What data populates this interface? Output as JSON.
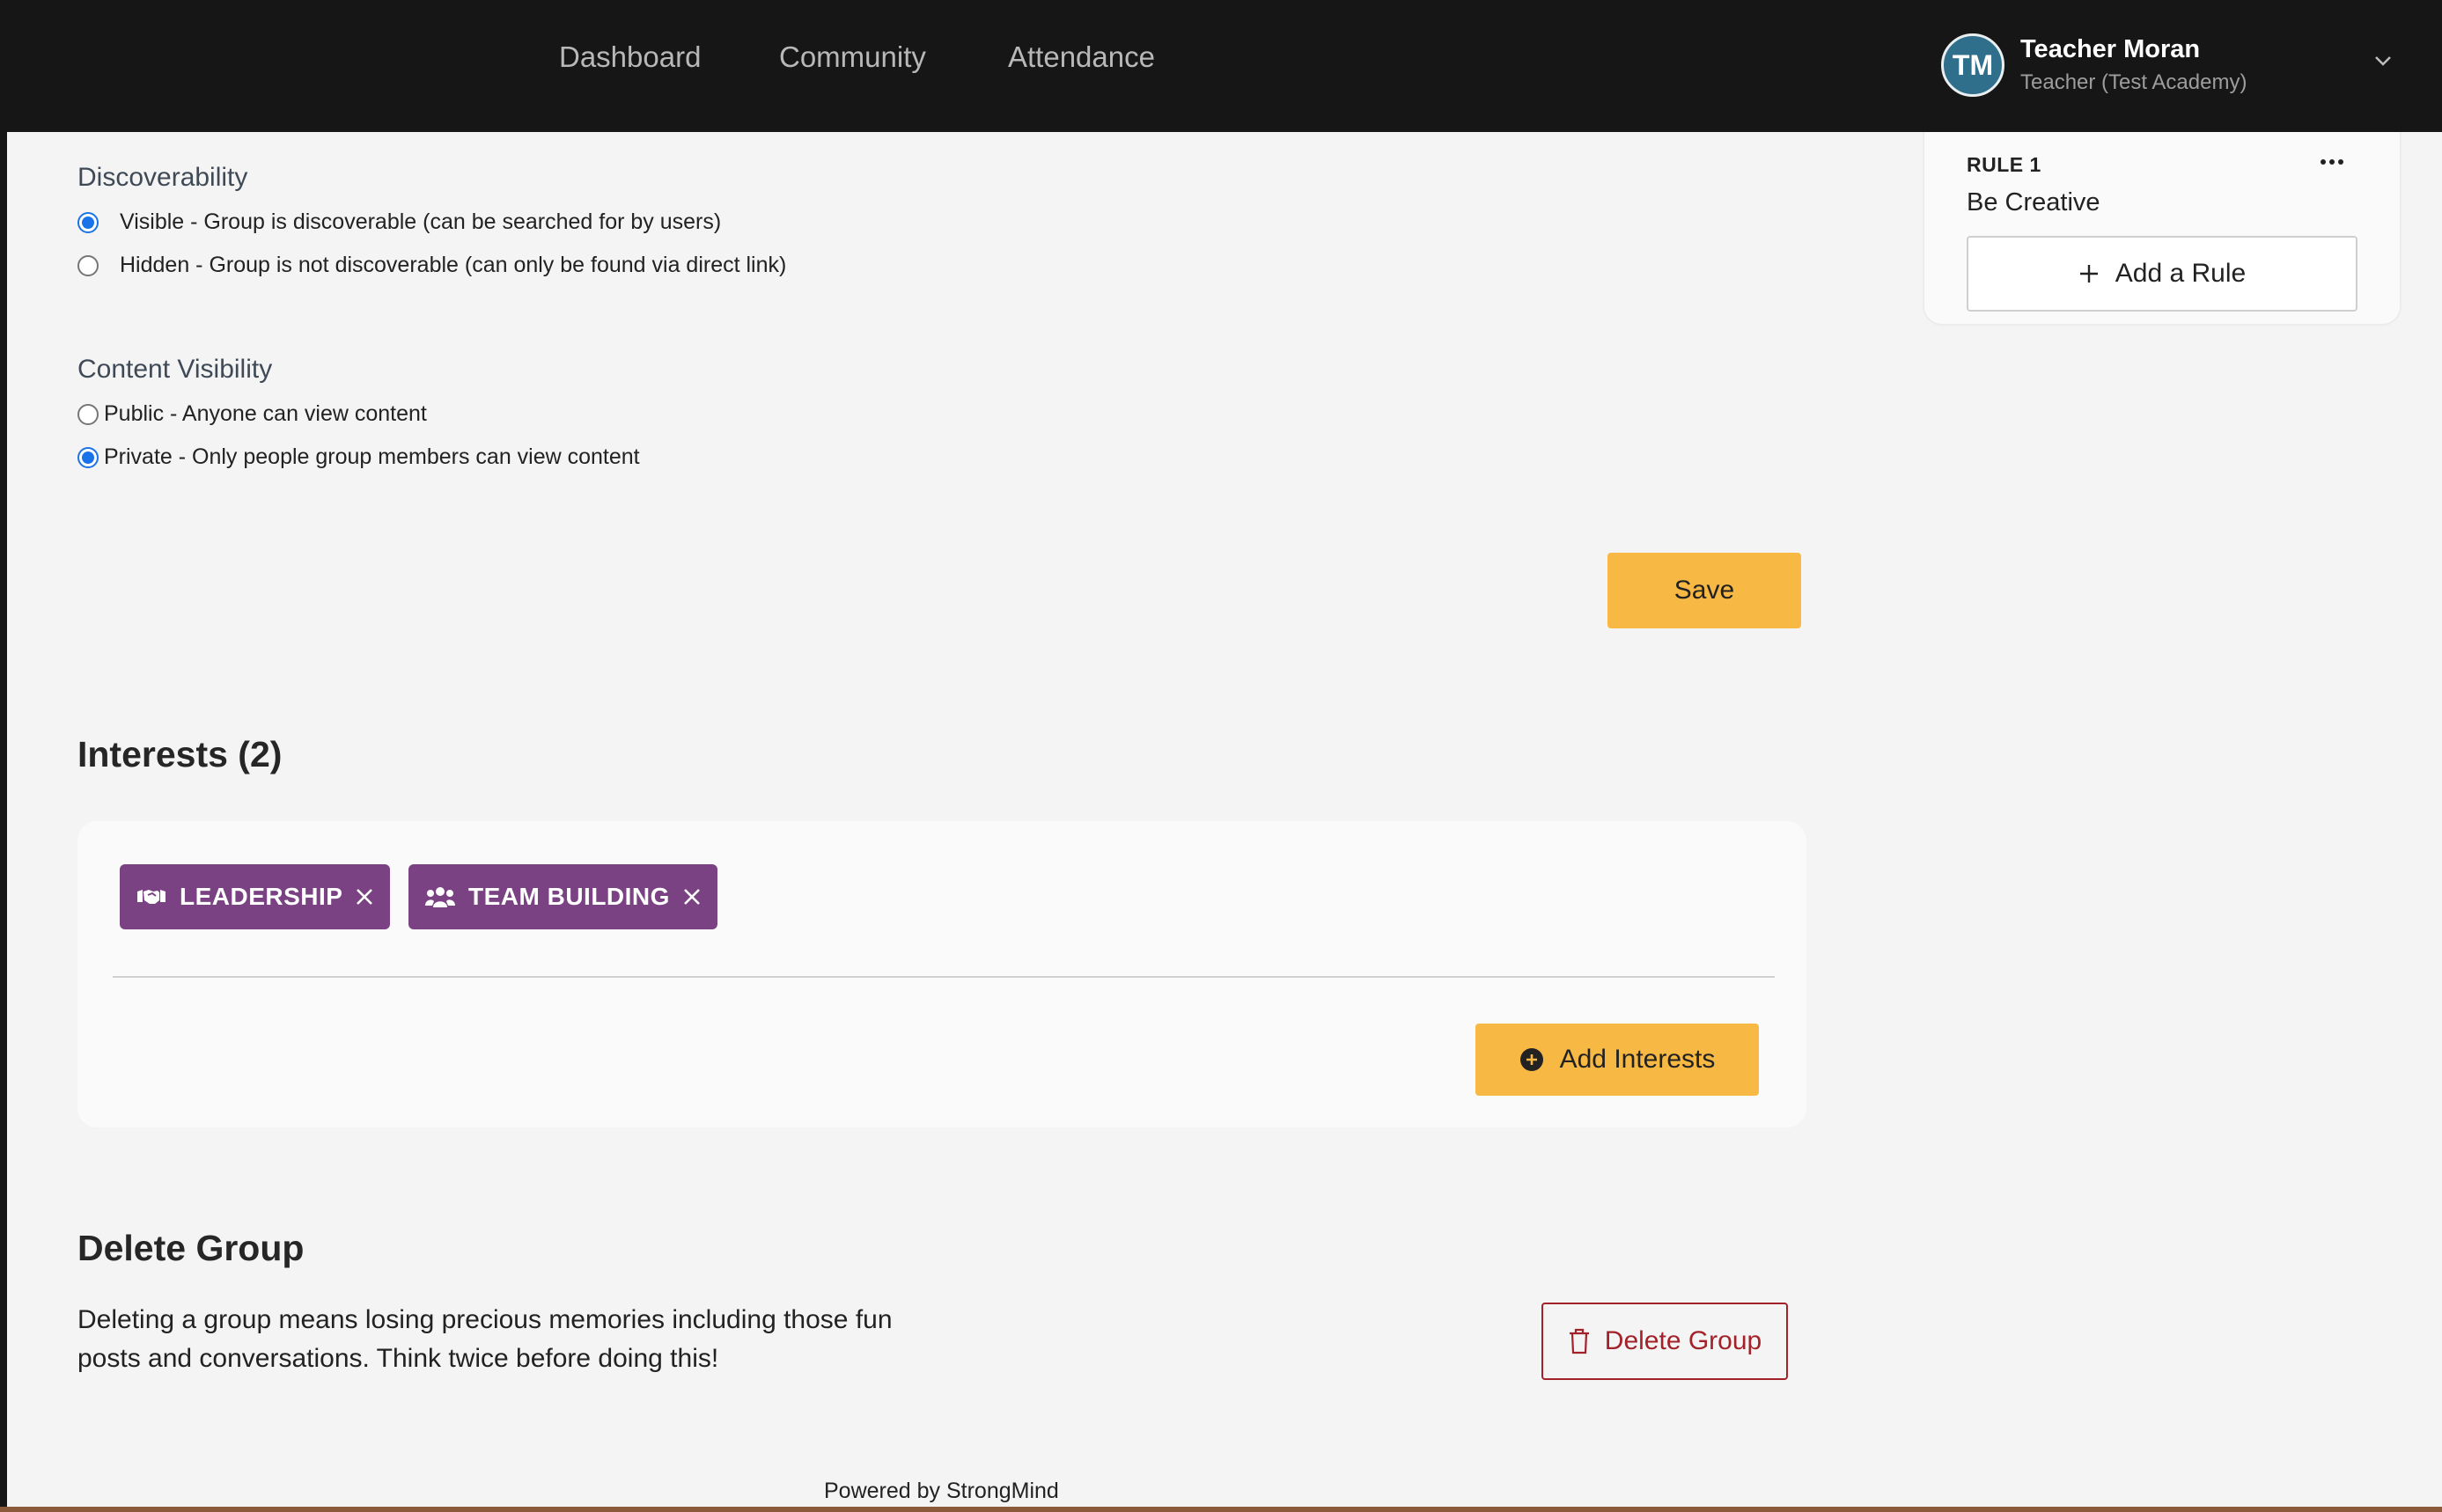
{
  "nav": {
    "links": [
      "Dashboard",
      "Community",
      "Attendance"
    ]
  },
  "user": {
    "initials": "TM",
    "name": "Teacher Moran",
    "role": "Teacher (Test Academy)"
  },
  "discoverability": {
    "label": "Discoverability",
    "options": [
      {
        "text": "Visible - Group is discoverable (can be searched for by users)",
        "checked": true
      },
      {
        "text": "Hidden - Group is not discoverable (can only be found via direct link)",
        "checked": false
      }
    ]
  },
  "content_visibility": {
    "label": "Content Visibility",
    "options": [
      {
        "text": "Public - Anyone can view content",
        "checked": false
      },
      {
        "text": "Private - Only people group members can view content",
        "checked": true
      }
    ]
  },
  "save_label": "Save",
  "interests": {
    "heading": "Interests (2)",
    "chips": [
      {
        "label": "LEADERSHIP",
        "icon": "handshake-icon"
      },
      {
        "label": "TEAM BUILDING",
        "icon": "users-icon"
      }
    ],
    "add_label": "Add Interests"
  },
  "delete_group": {
    "heading": "Delete Group",
    "description": "Deleting a group means losing precious memories including those fun posts and conversations. Think twice before doing this!",
    "button_label": "Delete Group"
  },
  "rules": {
    "rule_label": "RULE 1",
    "rule_text": "Be Creative",
    "add_label": "Add a Rule"
  },
  "footer": {
    "text": "Powered by StrongMind"
  },
  "colors": {
    "accent_yellow": "#f7b944",
    "chip_purple": "#7a4183",
    "danger_red": "#a3222a",
    "radio_blue": "#1a73e8"
  }
}
